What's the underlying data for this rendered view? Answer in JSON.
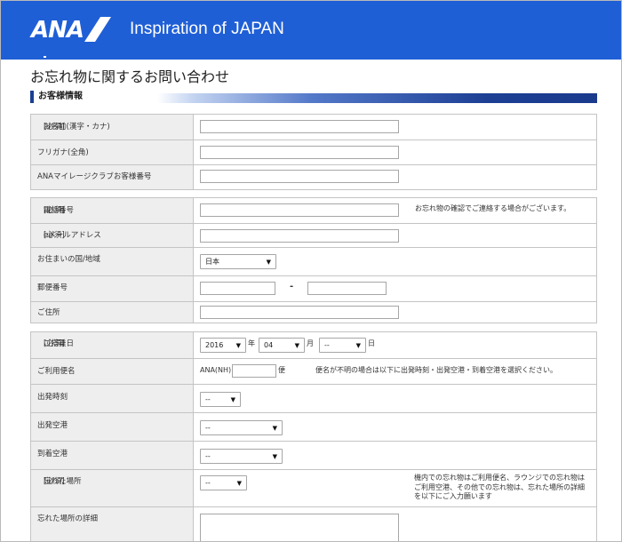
{
  "header": {
    "logo_text": "ANA",
    "tagline": "Inspiration of JAPAN",
    "brand_color": "#1f5fd6"
  },
  "page": {
    "title": "お忘れ物に関するお問い合わせ",
    "section_title": "お客様情報"
  },
  "required_mark": "[必須]",
  "group1": {
    "name_label": "お名前(漢字・カナ)",
    "furigana_label": "フリガナ(全角)",
    "mileage_label": "ANAマイレージクラブお客様番号"
  },
  "group2": {
    "phone_label": "電話番号",
    "phone_note": "お忘れ物の確認でご連絡する場合がございます。",
    "email_label": "eメールアドレス",
    "country_label": "お住まいの国/地域",
    "country_value": "日本",
    "postal_label": "郵便番号",
    "postal_sep": "-",
    "address_label": "ご住所"
  },
  "group3": {
    "date_label": "ご搭乗日",
    "year_value": "2016",
    "year_unit": "年",
    "month_value": "04",
    "month_unit": "月",
    "day_value": "--",
    "day_unit": "日",
    "flight_label": "ご利用便名",
    "flight_prefix": "ANA(NH)",
    "flight_unit": "便",
    "flight_note": "便名が不明の場合は以下に出発時刻・出発空港・到着空港を選択ください。",
    "dep_time_label": "出発時刻",
    "dep_time_value": "--",
    "dep_airport_label": "出発空港",
    "dep_airport_value": "--",
    "arr_airport_label": "到着空港",
    "arr_airport_value": "--",
    "place_label": "忘れた場所",
    "place_value": "--",
    "place_note_1": "機内での忘れ物はご利用便名、ラウンジでの忘れ物は",
    "place_note_2": "ご利用空港、その他での忘れ物は、忘れた場所の詳細",
    "place_note_3": "を以下にご入力願います",
    "detail_label": "忘れた場所の詳細"
  }
}
